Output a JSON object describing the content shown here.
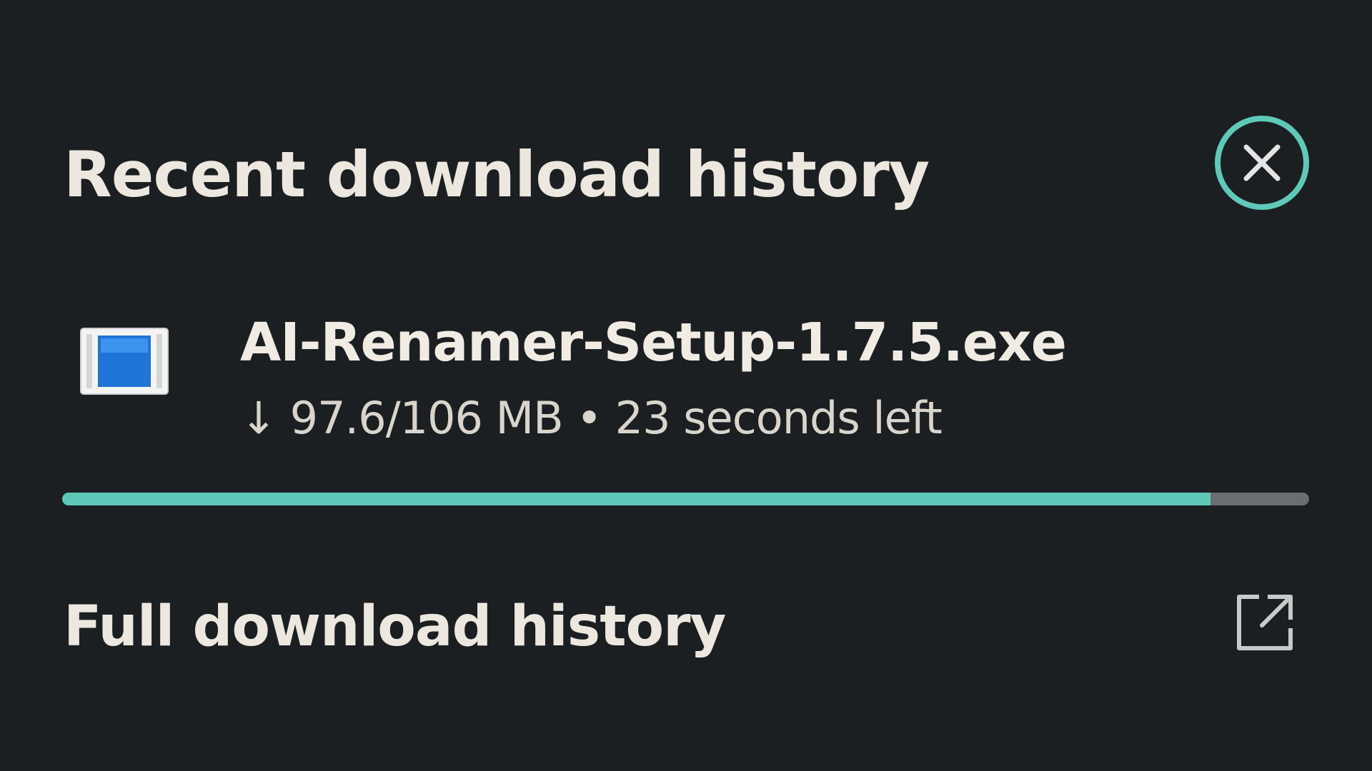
{
  "header": {
    "title": "Recent download history",
    "close_icon": "close-circle-icon"
  },
  "download": {
    "file_name": "AI-Renamer-Setup-1.7.5.exe",
    "file_icon": "executable-file-icon",
    "status": "↓ 97.6/106 MB • 23 seconds left",
    "progress_fraction": 0.921
  },
  "footer": {
    "full_history_label": "Full download history",
    "open_icon": "open-external-icon"
  },
  "colors": {
    "background": "#1b1f21",
    "accent": "#5ec9b9",
    "track": "#6b6e70",
    "text": "#ece8df"
  }
}
